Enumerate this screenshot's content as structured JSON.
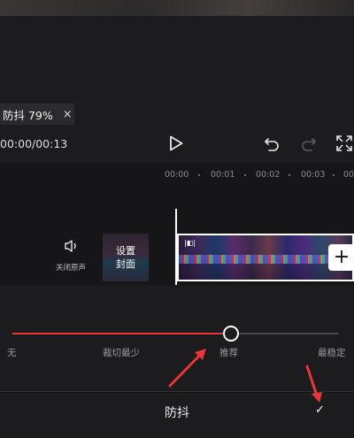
{
  "stabilization_tag": {
    "label": "防抖 79%",
    "close_glyph": "×"
  },
  "playback": {
    "timecode": "00:00/00:13"
  },
  "ruler": {
    "ticks": [
      "00:00",
      "00:01",
      "00:02",
      "00:03",
      "00:0"
    ]
  },
  "track": {
    "mute_label": "关闭原声",
    "cover_line1": "设置",
    "cover_line2": "封面",
    "add_glyph": "+"
  },
  "stabilization": {
    "options": [
      "无",
      "裁切最少",
      "推荐",
      "最稳定"
    ],
    "selected": "推荐",
    "level_fraction": 0.67
  },
  "bottom": {
    "title": "防抖",
    "confirm_glyph": "✓"
  },
  "colors": {
    "accent": "#e8353b",
    "background": "#1c1c1e"
  }
}
